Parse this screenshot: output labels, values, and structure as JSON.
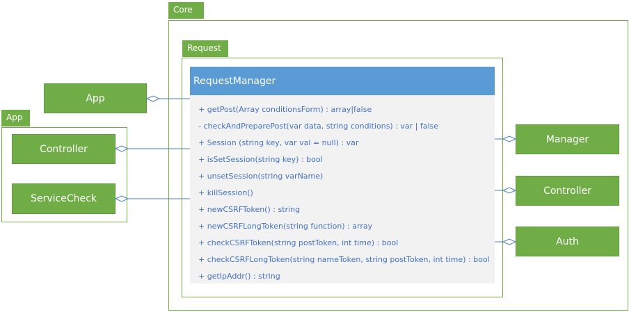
{
  "core_package": {
    "label": "Core"
  },
  "request_package": {
    "label": "Request"
  },
  "app_package": {
    "label": "App"
  },
  "class": {
    "name": "RequestManager",
    "methods": [
      "+ getPost(Array conditionsForm) : array|false",
      "- checkAndPreparePost(var data, string conditions) : var | false",
      "+ Session (string key, var val = null) : var",
      "+ isSetSession(string key) : bool",
      "+ unsetSession(string varName)",
      "+ killSession()",
      "+ newCSRFToken() : string",
      "+ newCSRFLongToken(string function) : array",
      "+ checkCSRFToken(string postToken, int time) : bool",
      "+ checkCSRFLongToken(string nameToken, string postToken, int time) : bool",
      "+ getIpAddr() : string"
    ]
  },
  "nodes": {
    "app": "App",
    "controller_left": "Controller",
    "service_check": "ServiceCheck",
    "manager": "Manager",
    "controller_right": "Controller",
    "auth": "Auth"
  },
  "colors": {
    "package_green": "#70ad47",
    "class_header_blue": "#5b9bd5",
    "class_body_gray": "#f2f2f2",
    "method_text_blue": "#4472c4",
    "connector_blue": "#4a7ebb"
  }
}
